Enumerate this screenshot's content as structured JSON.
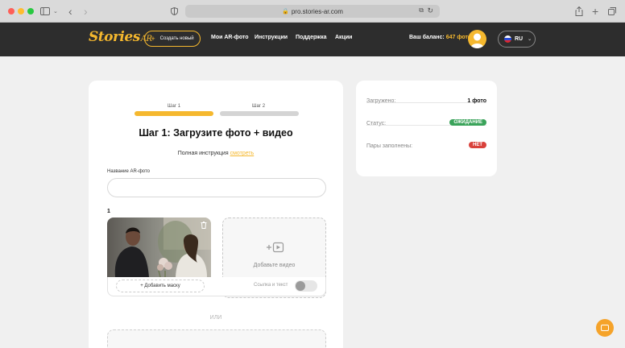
{
  "browser": {
    "url": "pro.stories-ar.com"
  },
  "header": {
    "logo_main": "Stories",
    "logo_sub": "AR",
    "create_button": "Создать новый",
    "nav": [
      "Мои AR-фото",
      "Инструкции",
      "Поддержка",
      "Акции"
    ],
    "balance_label": "Ваш баланс:",
    "balance_value": "647 фото",
    "language": "RU"
  },
  "form": {
    "steps": [
      {
        "label": "Шаг 1",
        "active": true
      },
      {
        "label": "Шаг 2",
        "active": false
      }
    ],
    "title": "Шаг 1: Загрузите фото + видео",
    "instruction_text": "Полная инструкция",
    "instruction_link": "смотреть",
    "name_label": "Название AR-фото",
    "name_value": "",
    "pair_number": "1",
    "add_video_text": "Добавьте видео",
    "add_mask_button": "+ Добавить маску",
    "link_text_label": "Ссылка и текст",
    "or_text": "ИЛИ"
  },
  "status": {
    "rows": [
      {
        "label": "Загружено:",
        "value": "1 фото",
        "type": "text"
      },
      {
        "label": "Статус:",
        "value": "ОЖИДАНИЕ",
        "type": "badge",
        "color": "#3aa35a"
      },
      {
        "label": "Пары заполнены:",
        "value": "НЕТ",
        "type": "badge",
        "color": "#d9413b"
      }
    ]
  },
  "colors": {
    "accent": "#f5b82e",
    "header_bg": "#2d2d2d"
  }
}
